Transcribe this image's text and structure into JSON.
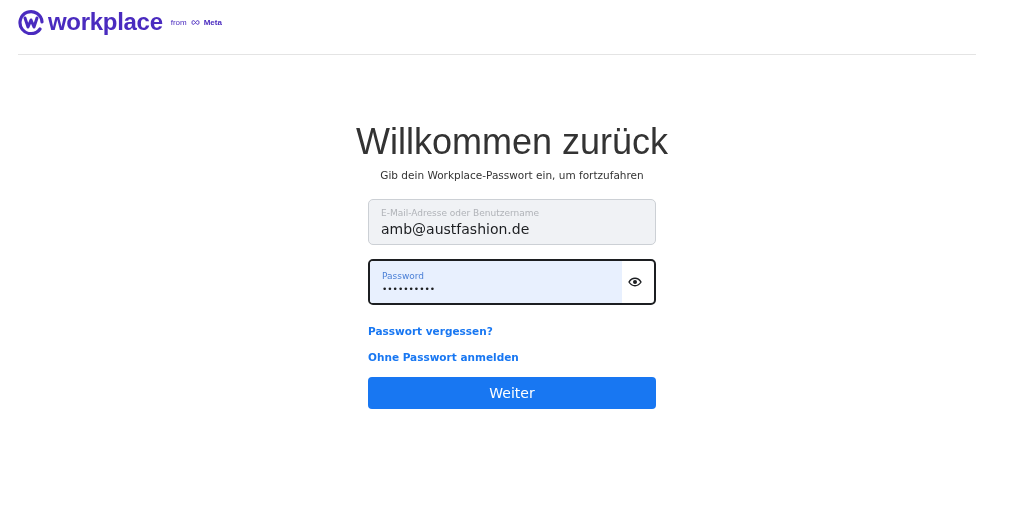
{
  "header": {
    "brand": "workplace",
    "from": "from",
    "meta": "Meta"
  },
  "title": "Willkommen zurück",
  "subtitle": "Gib dein Workplace-Passwort ein, um fortzufahren",
  "fields": [
    {
      "kind": "text",
      "label": "E-Mail-Adresse oder Benutzername",
      "value": "amb@austfashion.de",
      "focused": false
    },
    {
      "kind": "password",
      "label": "Password",
      "value": "••••••••••",
      "focused": true
    }
  ],
  "links": [
    "Passwort vergessen?",
    "Ohne Passwort anmelden"
  ],
  "button": "Weiter"
}
